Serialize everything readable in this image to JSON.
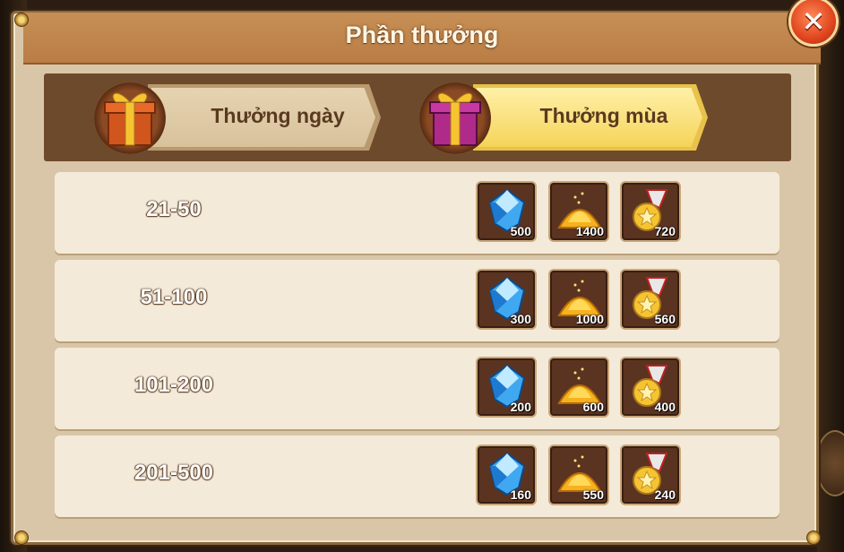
{
  "window": {
    "title": "Phần thưởng"
  },
  "tabs": [
    {
      "label": "Thưởng ngày",
      "active": false,
      "gift_color": "#d0561e"
    },
    {
      "label": "Thưởng mùa",
      "active": true,
      "gift_color": "#b02a8a"
    }
  ],
  "rewards": [
    {
      "rank": "21-50",
      "items": [
        {
          "icon": "diamond-icon",
          "count": "500"
        },
        {
          "icon": "gold-pile-icon",
          "count": "1400"
        },
        {
          "icon": "medal-icon",
          "count": "720"
        }
      ]
    },
    {
      "rank": "51-100",
      "items": [
        {
          "icon": "diamond-icon",
          "count": "300"
        },
        {
          "icon": "gold-pile-icon",
          "count": "1000"
        },
        {
          "icon": "medal-icon",
          "count": "560"
        }
      ]
    },
    {
      "rank": "101-200",
      "items": [
        {
          "icon": "diamond-icon",
          "count": "200"
        },
        {
          "icon": "gold-pile-icon",
          "count": "600"
        },
        {
          "icon": "medal-icon",
          "count": "400"
        }
      ]
    },
    {
      "rank": "201-500",
      "items": [
        {
          "icon": "diamond-icon",
          "count": "160"
        },
        {
          "icon": "gold-pile-icon",
          "count": "550"
        },
        {
          "icon": "medal-icon",
          "count": "240"
        }
      ]
    }
  ],
  "colors": {
    "accent": "#f6d45a",
    "panel": "#d9c6a8",
    "close": "#e0441e"
  }
}
